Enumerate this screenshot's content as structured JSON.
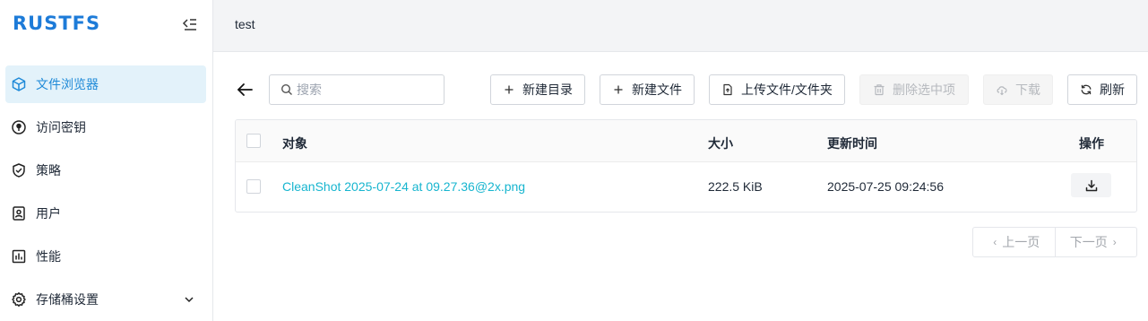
{
  "app": {
    "logo_text": "RUSTFS",
    "brand_color": "#1d7bd8",
    "accent_color": "#17b5cf"
  },
  "sidebar": {
    "collapse_icon": "menu-fold-icon",
    "items": [
      {
        "label": "文件浏览器",
        "icon": "cube-icon",
        "active": true
      },
      {
        "label": "访问密钥",
        "icon": "key-circle-icon",
        "active": false
      },
      {
        "label": "策略",
        "icon": "shield-check-icon",
        "active": false
      },
      {
        "label": "用户",
        "icon": "user-badge-icon",
        "active": false
      },
      {
        "label": "性能",
        "icon": "bar-chart-icon",
        "active": false
      },
      {
        "label": "存储桶设置",
        "icon": "gear-icon",
        "active": false,
        "expandable": true
      }
    ]
  },
  "header": {
    "title": "test"
  },
  "toolbar": {
    "search_placeholder": "搜索",
    "buttons": {
      "new_folder": "新建目录",
      "new_file": "新建文件",
      "upload": "上传文件/文件夹",
      "delete_selected": "删除选中项",
      "download": "下载",
      "refresh": "刷新"
    }
  },
  "table": {
    "columns": {
      "object": "对象",
      "size": "大小",
      "updated": "更新时间",
      "actions": "操作"
    },
    "rows": [
      {
        "name": "CleanShot 2025-07-24 at 09.27.36@2x.png",
        "size": "222.5 KiB",
        "updated": "2025-07-25 09:24:56"
      }
    ]
  },
  "pagination": {
    "prev": "上一页",
    "next": "下一页"
  }
}
